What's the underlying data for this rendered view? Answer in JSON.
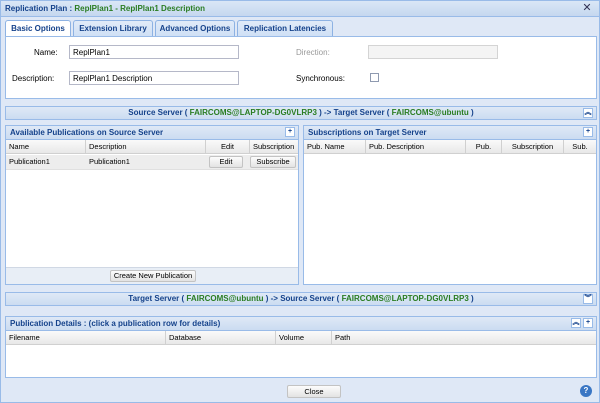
{
  "window": {
    "title_prefix": "Replication Plan : ",
    "title_plan": "ReplPlan1 - ReplPlan1 Description"
  },
  "tabs": [
    {
      "label": "Basic Options",
      "active": true
    },
    {
      "label": "Extension Library",
      "active": false
    },
    {
      "label": "Advanced Options",
      "active": false
    },
    {
      "label": "Replication Latencies",
      "active": false
    }
  ],
  "basic": {
    "name_label": "Name:",
    "name_value": "ReplPlan1",
    "description_label": "Description:",
    "description_value": "ReplPlan1 Description",
    "direction_label": "Direction:",
    "direction_value": "",
    "synchronous_label": "Synchronous:",
    "synchronous_checked": false
  },
  "source_strip": {
    "pre": "Source Server ( ",
    "source": "FAIRCOMS@LAPTOP-DG0VLRP3",
    "mid": " ) -> Target Server ( ",
    "target": "FAIRCOMS@ubuntu",
    "post": " )"
  },
  "target_strip": {
    "pre": "Target Server ( ",
    "target": "FAIRCOMS@ubuntu",
    "mid": " ) -> Source Server ( ",
    "source": "FAIRCOMS@LAPTOP-DG0VLRP3",
    "post": " )"
  },
  "available_publications": {
    "title": "Available Publications on Source Server",
    "columns": [
      "Name",
      "Description",
      "Edit",
      "Subscription"
    ],
    "rows": [
      {
        "name": "Publication1",
        "description": "Publication1",
        "edit_label": "Edit",
        "subscribe_label": "Subscribe"
      }
    ],
    "create_button": "Create New Publication"
  },
  "subscriptions": {
    "title": "Subscriptions on Target Server",
    "columns": [
      "Pub. Name",
      "Pub. Description",
      "Pub.",
      "Subscription",
      "Sub."
    ]
  },
  "publication_details": {
    "title": "Publication Details : (click a publication row for details)",
    "columns": [
      "Filename",
      "Database",
      "Volume",
      "Path"
    ]
  },
  "footer": {
    "close_label": "Close",
    "help_glyph": "?"
  },
  "colors": {
    "accent_blue": "#15428b",
    "server_green": "#2a7d22",
    "panel_border": "#99bbe8"
  }
}
